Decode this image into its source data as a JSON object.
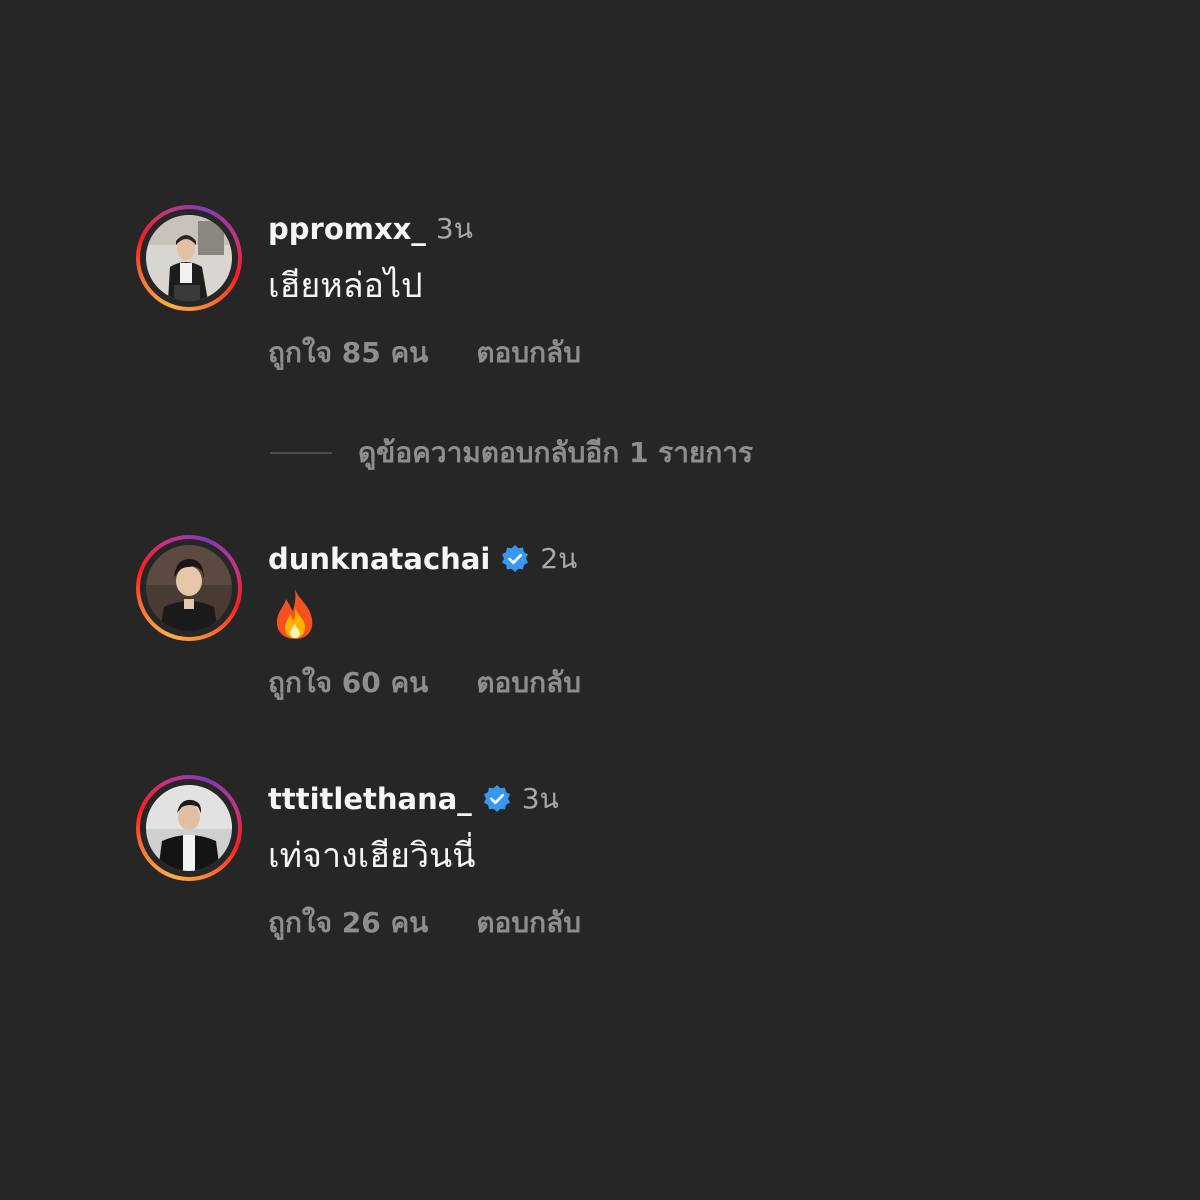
{
  "comments": [
    {
      "username": "ppromxx_",
      "verified": false,
      "time": "3น",
      "text": "เฮียหล่อไป",
      "likes": "ถูกใจ 85 คน",
      "reply": "ตอบกลับ"
    },
    {
      "username": "dunknatachai",
      "verified": true,
      "time": "2น",
      "text": "",
      "emoji": "fire-emoji",
      "likes": "ถูกใจ 60 คน",
      "reply": "ตอบกลับ"
    },
    {
      "username": "tttitlethana_",
      "verified": true,
      "time": "3น",
      "text": "เท่จางเฮียวินนี่",
      "likes": "ถูกใจ 26 คน",
      "reply": "ตอบกลับ"
    }
  ],
  "view_replies": "ดูข้อความตอบกลับอีก 1 รายการ",
  "colors": {
    "background": "#262626",
    "primary_text": "#f5f5f5",
    "secondary_text": "#8e8e8e",
    "verified_blue": "#3897f0"
  }
}
